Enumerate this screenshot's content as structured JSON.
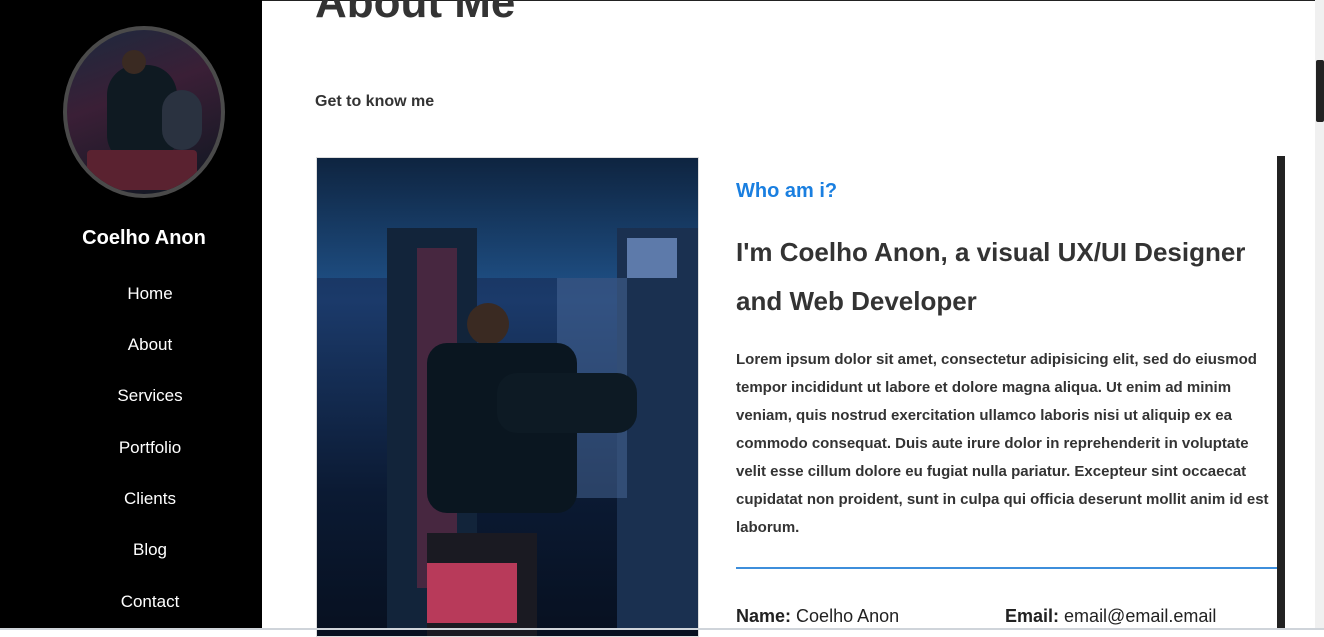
{
  "sidebar": {
    "name": "Coelho Anon",
    "nav": [
      "Home",
      "About",
      "Services",
      "Portfolio",
      "Clients",
      "Blog",
      "Contact"
    ]
  },
  "main": {
    "title": "About Me",
    "subtitle": "Get to know me",
    "who": "Who am i?",
    "headline": "I'm Coelho Anon, a visual UX/UI Designer and Web Developer",
    "bio": "Lorem ipsum dolor sit amet, consectetur adipisicing elit, sed do eiusmod tempor incididunt ut labore et dolore magna aliqua. Ut enim ad minim veniam, quis nostrud exercitation ullamco laboris nisi ut aliquip ex ea commodo consequat. Duis aute irure dolor in reprehenderit in voluptate velit esse cillum dolore eu fugiat nulla pariatur. Excepteur sint occaecat cupidatat non proident, sunt in culpa qui officia deserunt mollit anim id est laborum.",
    "info": {
      "name_label": "Name:",
      "name_value": "Coelho Anon",
      "email_label": "Email:",
      "email_value": "email@email.email"
    }
  },
  "colors": {
    "accent": "#1a7fe0",
    "sidebar_bg": "#000000",
    "divider": "#3d8edb"
  }
}
